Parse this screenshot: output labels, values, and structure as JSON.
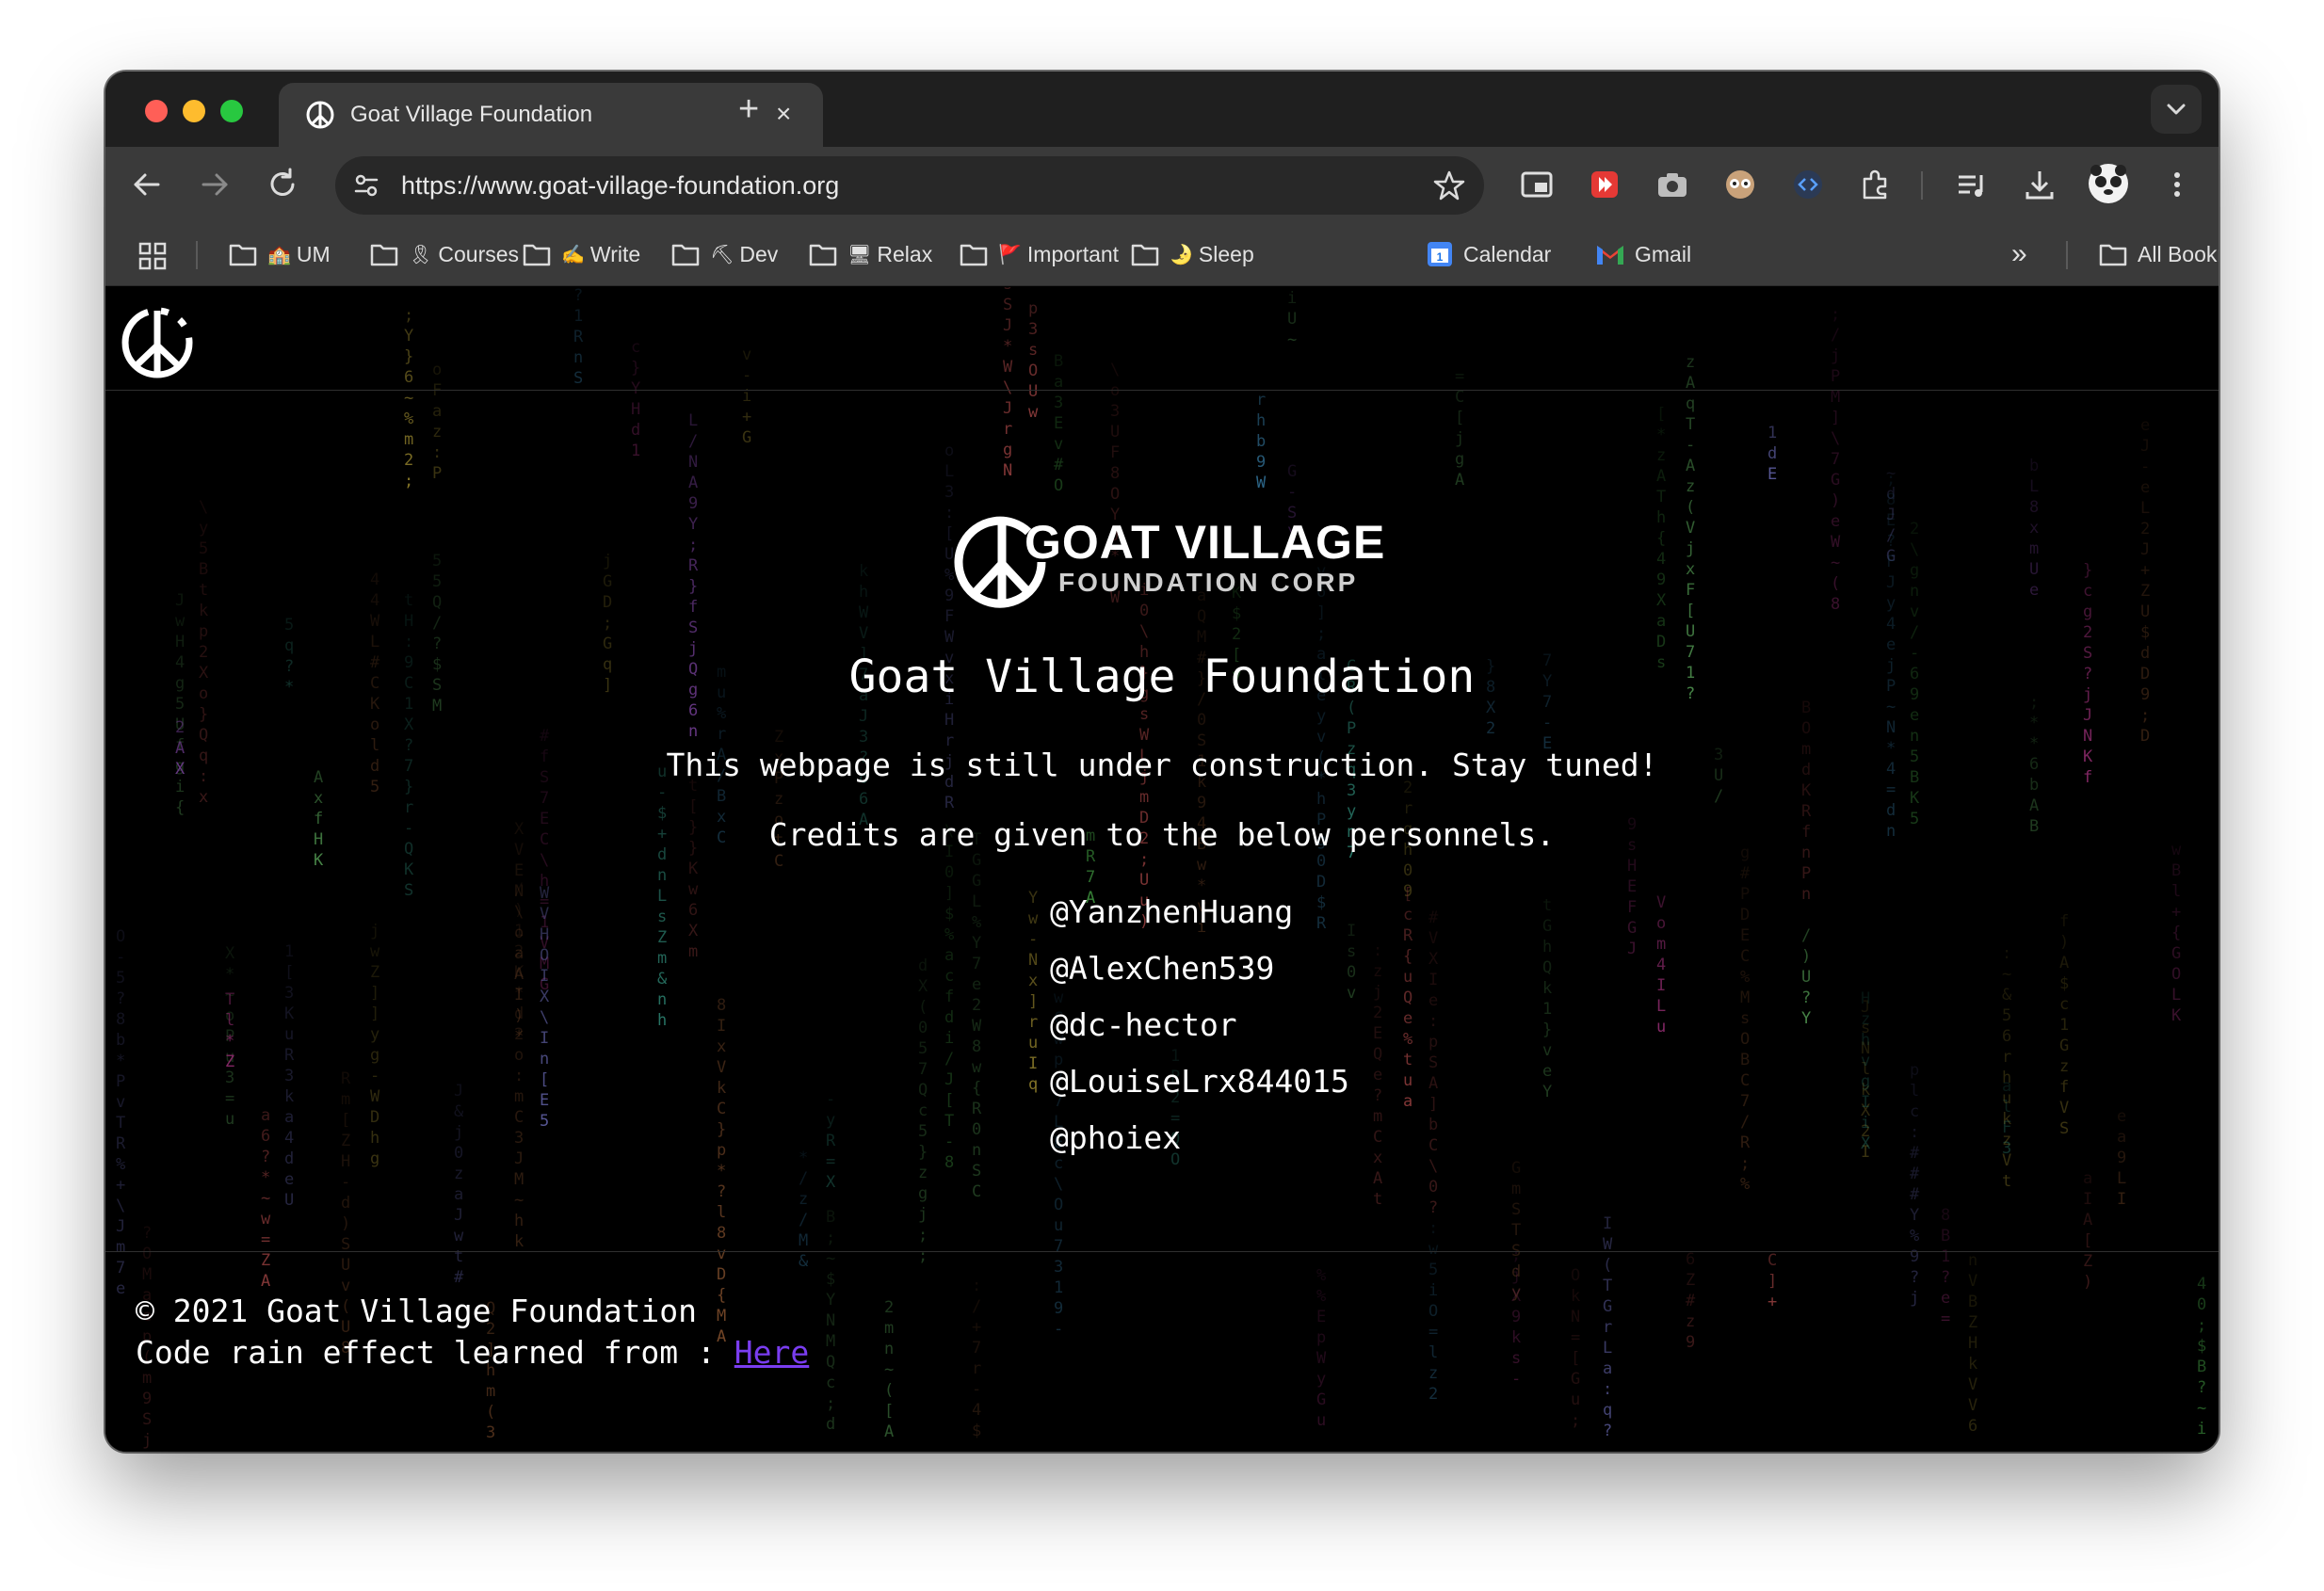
{
  "browser": {
    "tab_title": "Goat Village Foundation",
    "tab_close": "×",
    "new_tab": "+",
    "url": "https://www.goat-village-foundation.org",
    "bookmarks": [
      {
        "label": "UM",
        "emoji": "🏫"
      },
      {
        "label": "Courses",
        "emoji": "🎗"
      },
      {
        "label": "Write",
        "emoji": "✍"
      },
      {
        "label": "Dev",
        "emoji": "⛏"
      },
      {
        "label": "Relax",
        "emoji": "🖥"
      },
      {
        "label": "Important",
        "emoji": "🚩"
      },
      {
        "label": "Sleep",
        "emoji": "🌛"
      }
    ],
    "calendar_label": "Calendar",
    "calendar_badge": "1",
    "gmail_label": "Gmail",
    "overflow": "»",
    "all_bookmarks": "All Bookmarks"
  },
  "page": {
    "logo_line1": "GOAT VILLAGE",
    "logo_line2": "FOUNDATION CORP",
    "title": "Goat Village Foundation",
    "tagline": "This webpage is still under construction. Stay tuned!",
    "credits": "Credits are given to the below personnels.",
    "personnel": [
      "@YanzhenHuang",
      "@AlexChen539",
      "@dc-hector",
      "@LouiseLrx844015",
      "@phoiex"
    ],
    "footer_copyright": "© 2021 Goat Village Foundation",
    "footer_credit": "Code rain effect learned from : ",
    "footer_link": "Here"
  },
  "colors": {
    "tab_bg": "#3a3a3a",
    "titlebar_bg": "#1f1f1f",
    "page_bg": "#000000",
    "link": "#7a3df0"
  }
}
